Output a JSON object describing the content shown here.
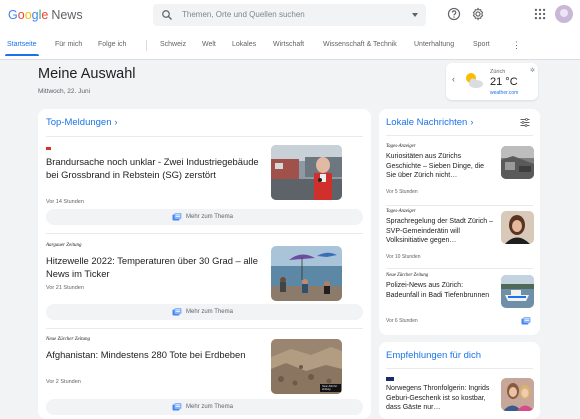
{
  "header": {
    "logo_google": [
      "G",
      "o",
      "o",
      "g",
      "l",
      "e"
    ],
    "logo_news": "News",
    "search_placeholder": "Themen, Orte und Quellen suchen"
  },
  "nav": {
    "tabs": [
      "Startseite",
      "Für mich",
      "Folge ich",
      "Schweiz",
      "Welt",
      "Lokales",
      "Wirtschaft",
      "Wissenschaft & Technik",
      "Unterhaltung",
      "Sport"
    ],
    "active": "Startseite",
    "more": "⋮"
  },
  "page": {
    "title": "Meine Auswahl",
    "date": "Mittwoch, 22. Juni"
  },
  "weather": {
    "city": "Zürich",
    "temp": "21 °C",
    "source": "weather.com"
  },
  "top": {
    "title": "Top-Meldungen",
    "more_label": "Mehr zum Thema",
    "stories": [
      {
        "publisher": "",
        "headline": "Brandursache noch unklar - Zwei Industriegebäude bei Grossbrand in Rebstein (SG) zerstört",
        "time": "Vor 14 Stunden"
      },
      {
        "publisher": "Aargauer Zeitung",
        "headline": "Hitzewelle 2022: Temperaturen über 30 Grad – alle News im Ticker",
        "time": "Vor 21 Stunden"
      },
      {
        "publisher": "Neue Zürcher Zeitung",
        "headline": "Afghanistan: Mindestens 280 Tote bei Erdbeben",
        "time": "Vor 2 Stunden",
        "thumb_caption": "Neue Zürcher Zeitung"
      }
    ]
  },
  "local": {
    "title": "Lokale Nachrichten",
    "stories": [
      {
        "publisher": "Tages-Anzeiger",
        "headline": "Kuriositäten aus Zürichs Geschichte – Sieben Dinge, die Sie über Zürich nicht…",
        "time": "Vor 5 Stunden"
      },
      {
        "publisher": "Tages-Anzeiger",
        "headline": "Sprachregelung der Stadt Zürich – SVP-Gemeinderätin will Volksinitiative gegen…",
        "time": "Vor 10 Stunden"
      },
      {
        "publisher": "Neue Zürcher Zeitung",
        "headline": "Polizei-News aus Zürich: Badeunfall in Badi Tiefenbrunnen",
        "time": "Vor 6 Stunden"
      }
    ]
  },
  "recommended": {
    "title": "Empfehlungen für dich",
    "story": {
      "headline": "Norwegens Thronfolgerin: Ingrids Geburi-Geschenk ist so kostbar, dass Gäste nur…"
    }
  },
  "colors": {
    "accent": "#1a73e8",
    "bg": "#f1f3f4"
  }
}
